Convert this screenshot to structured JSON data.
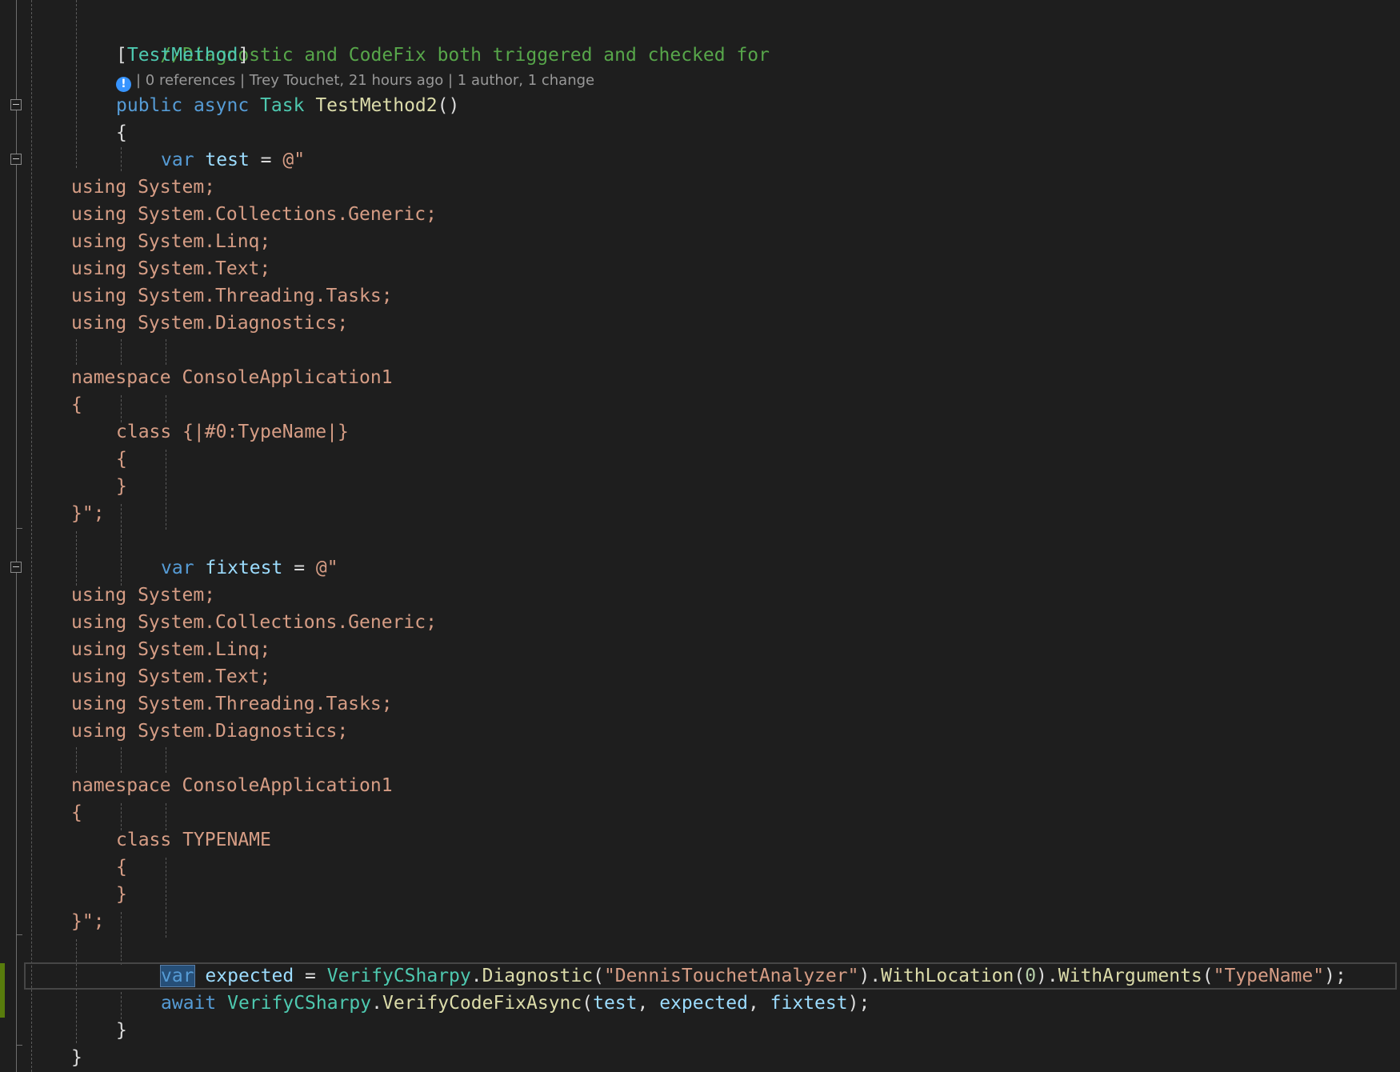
{
  "editor": {
    "lines": {
      "l01": "//Diagnostic and CodeFix both triggered and checked for",
      "l02_open": "[",
      "l02_attr": "TestMethod",
      "l02_close": "]",
      "l04_kw1": "public",
      "l04_kw2": "async",
      "l04_type": "Task",
      "l04_method": "TestMethod2",
      "l04_parens": "()",
      "l05": "{",
      "l06_kw": "var",
      "l06_name": "test",
      "l06_eq": " = ",
      "l06_str": "@\"",
      "u1": "using System;",
      "u2": "using System.Collections.Generic;",
      "u3": "using System.Linq;",
      "u4": "using System.Text;",
      "u5": "using System.Threading.Tasks;",
      "u6": "using System.Diagnostics;",
      "ns": "namespace ConsoleApplication1",
      "ob": "{",
      "cls1": "class {|#0:TypeName|}",
      "cob": "{",
      "ccb": "}",
      "end1": "}\";",
      "l20_kw": "var",
      "l20_name": "fixtest",
      "l20_eq": " = ",
      "l20_str": "@\"",
      "cls2": "class TYPENAME",
      "end2": "}\";",
      "e_kw": "var",
      "e_name": "expected",
      "e_eq": " = ",
      "e_type": "VerifyCSharpy",
      "e_dot1": ".",
      "e_m1": "Diagnostic",
      "e_p1o": "(",
      "e_s1": "\"DennisTouchetAnalyzer\"",
      "e_p1c": ").",
      "e_m2": "WithLocation",
      "e_p2o": "(",
      "e_n": "0",
      "e_p2c": ").",
      "e_m3": "WithArguments",
      "e_p3o": "(",
      "e_s2": "\"TypeName\"",
      "e_p3c": ");",
      "a_kw": "await",
      "a_type": "VerifyCSharpy",
      "a_dot": ".",
      "a_m": "VerifyCodeFixAsync",
      "a_po": "(",
      "a_v1": "test",
      "a_c1": ", ",
      "a_v2": "expected",
      "a_c2": ", ",
      "a_v3": "fixtest",
      "a_pc": ");",
      "close_method": "}",
      "close_class": "}"
    },
    "codelens": {
      "icon": "!",
      "text": "| 0 references | Trey Touchet, 21 hours ago | 1 author, 1 change"
    }
  },
  "colors": {
    "background": "#1e1e1e",
    "comment": "#57a64a",
    "keyword": "#569cd6",
    "type": "#4ec9b0",
    "method": "#dcdcaa",
    "variable": "#9cdcfe",
    "string": "#d69d85",
    "changed_line_marker": "#587c0c"
  }
}
